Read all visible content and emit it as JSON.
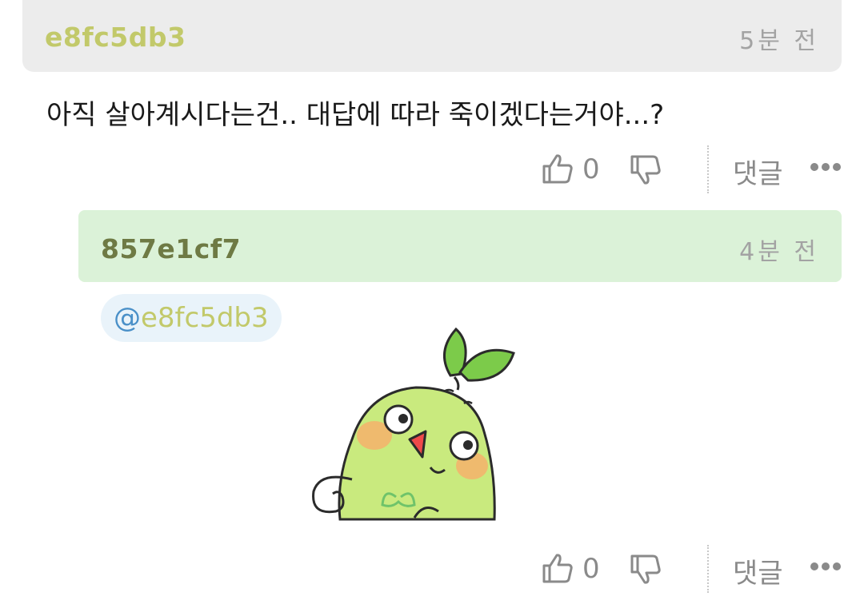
{
  "comment": {
    "author": "e8fc5db3",
    "time": "5분 전",
    "text": "아직 살아계시다는건.. 대답에 따라 죽이겠다는거야...?",
    "like_count": "0",
    "reply_label": "댓글"
  },
  "reply": {
    "author": "857e1cf7",
    "time": "4분 전",
    "mention_at": "@",
    "mention_name": "e8fc5db3",
    "like_count": "0",
    "reply_label": "댓글"
  },
  "icons": {
    "like": "thumbs-up-icon",
    "dislike": "thumbs-down-icon",
    "more": "more-dots-icon"
  },
  "colors": {
    "comment_header_bg": "#ececec",
    "reply_header_bg": "#dbf2d8",
    "author_color": "#c2c96a",
    "reply_author_color": "#6e7a44",
    "mention_at": "#4a90c8",
    "mention_bg": "#e9f3fa"
  }
}
